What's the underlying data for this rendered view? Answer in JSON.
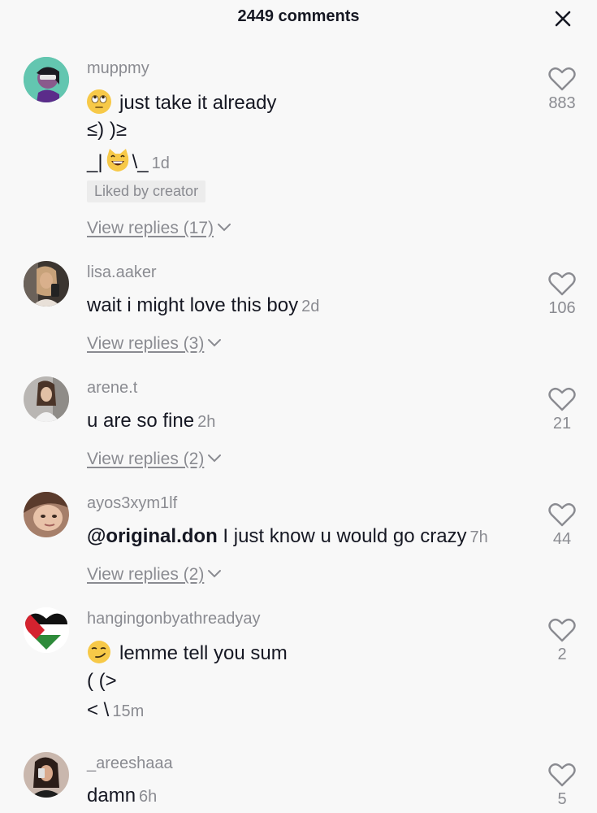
{
  "header": {
    "title": "2449 comments"
  },
  "comments": [
    {
      "username": "muppmy",
      "lines": [
        "just take it already",
        "≤) )≥",
        "_|",
        "\\_"
      ],
      "time": "1d",
      "badge": "Liked by creator",
      "replies": "View replies (17)",
      "likes": "883"
    },
    {
      "username": "lisa.aaker",
      "text": "wait i might love this boy",
      "time": "2d",
      "replies": "View replies (3)",
      "likes": "106"
    },
    {
      "username": "arene.t",
      "text": "u are so fine",
      "time": "2h",
      "replies": "View replies (2)",
      "likes": "21"
    },
    {
      "username": "ayos3xym1lf",
      "mention": "@original.don",
      "text": "I just know u would go crazy",
      "time": "7h",
      "replies": "View replies (2)",
      "likes": "44"
    },
    {
      "username": "hangingonbyathreadyay",
      "lines": [
        "lemme tell you sum",
        "( (>",
        "< \\"
      ],
      "time": "15m",
      "likes": "2"
    },
    {
      "username": "_areeshaaa",
      "text": "damn",
      "time": "6h",
      "likes": "5"
    }
  ],
  "colors": {
    "background": "#f8f8f8",
    "primary_text": "#161823",
    "secondary_text": "#8a8b91",
    "badge_bg": "#ececec"
  }
}
